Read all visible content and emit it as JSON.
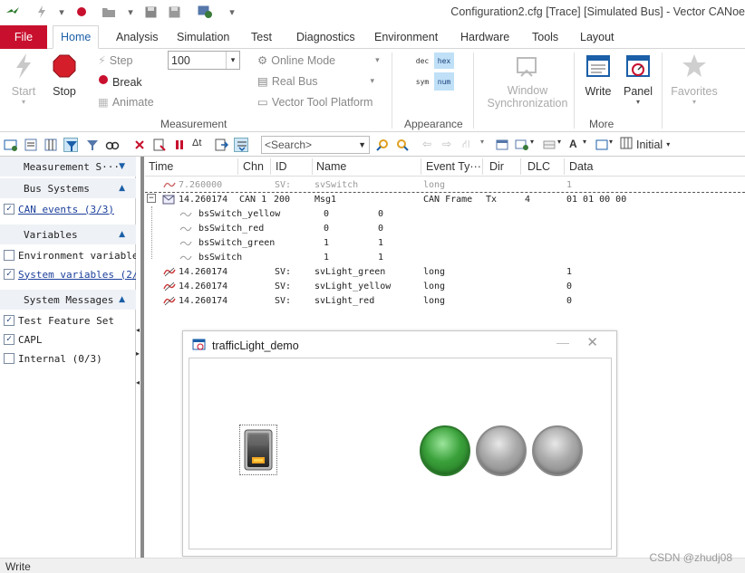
{
  "window": {
    "title": "Configuration2.cfg [Trace] [Simulated Bus] - Vector CANoe"
  },
  "menu": {
    "file": "File",
    "tabs": [
      "Home",
      "Analysis",
      "Simulation",
      "Test",
      "Diagnostics",
      "Environment",
      "Hardware",
      "Tools",
      "Layout"
    ],
    "active": "Home"
  },
  "ribbon": {
    "start": "Start",
    "stop": "Stop",
    "step": "Step",
    "break": "Break",
    "animate": "Animate",
    "speed_value": "100",
    "online_mode": "Online Mode",
    "real_bus": "Real Bus",
    "vtp": "Vector Tool Platform",
    "measurement_label": "Measurement",
    "hex": "hex",
    "dec": "dec",
    "sym": "sym",
    "num": "num",
    "appearance_label": "Appearance",
    "window_sync_1": "Window",
    "window_sync_2": "Synchronization",
    "write": "Write",
    "panel": "Panel",
    "favorites": "Favorites",
    "more_label": "More"
  },
  "toolbar": {
    "search_placeholder": "<Search>",
    "initial": "Initial"
  },
  "left_panel": {
    "measurement_setup": "Measurement S···",
    "bus_systems": "Bus Systems",
    "can_events": "CAN events (3/3)",
    "variables": "Variables",
    "env_vars": "Environment variables",
    "sys_vars": "System variables (2/3)",
    "system_messages": "System Messages",
    "test_feature_set": "Test Feature Set",
    "capl": "CAPL",
    "internal": "Internal (0/3)"
  },
  "trace": {
    "columns": [
      "Time",
      "Chn",
      "ID",
      "Name",
      "Event Ty···",
      "Dir",
      "DLC",
      "Data"
    ],
    "rows": [
      {
        "time": "7.260000",
        "chn": "",
        "id": "SV:",
        "name": "svSwitch",
        "type": "long",
        "dir": "",
        "dlc": "",
        "data": "1",
        "dim": true
      },
      {
        "time": "14.260174",
        "chn": "CAN 1",
        "id": "200",
        "name": "Msg1",
        "type": "CAN Frame",
        "dir": "Tx",
        "dlc": "4",
        "data": "01 01 00 00"
      },
      {
        "sig": "bsSwitch_yellow",
        "raw": "0",
        "phys": "0"
      },
      {
        "sig": "bsSwitch_red",
        "raw": "0",
        "phys": "0"
      },
      {
        "sig": "bsSwitch_green",
        "raw": "1",
        "phys": "1"
      },
      {
        "sig": "bsSwitch",
        "raw": "1",
        "phys": "1"
      },
      {
        "time": "14.260174",
        "chn": "",
        "id": "SV:",
        "name": "svLight_green",
        "type": "long",
        "dir": "",
        "dlc": "",
        "data": "1"
      },
      {
        "time": "14.260174",
        "chn": "",
        "id": "SV:",
        "name": "svLight_yellow",
        "type": "long",
        "dir": "",
        "dlc": "",
        "data": "0"
      },
      {
        "time": "14.260174",
        "chn": "",
        "id": "SV:",
        "name": "svLight_red",
        "type": "long",
        "dir": "",
        "dlc": "",
        "data": "0"
      }
    ]
  },
  "dialog": {
    "title": "trafficLight_demo",
    "minimize": "—",
    "close": "✕",
    "lights": [
      {
        "name": "green",
        "on": true
      },
      {
        "name": "yellow",
        "on": false
      },
      {
        "name": "red",
        "on": false
      }
    ],
    "switch_on": true
  },
  "status": {
    "text": "Write"
  },
  "watermark": "CSDN @zhudj08",
  "colors": {
    "accent": "#1b5fa8",
    "file_tab": "#c8102e",
    "lamp_on": "#3aa13a",
    "lamp_off": "#a9a9a9"
  }
}
